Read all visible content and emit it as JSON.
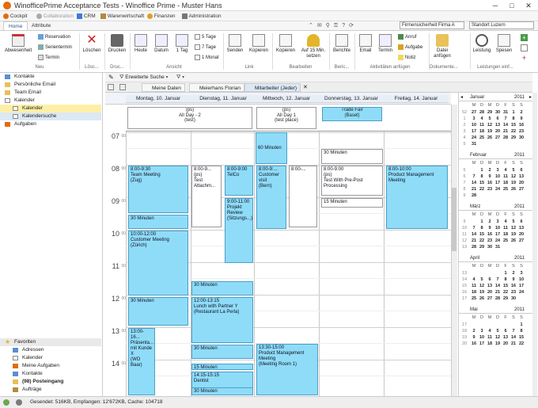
{
  "window": {
    "title": "WinofficePrime Acceptance Tests - Winoffice Prime - Muster Hans"
  },
  "topbar": {
    "items": [
      "Cockpit",
      "Collaboration",
      "CRM",
      "Warenwirtschaft",
      "Finanzen",
      "Administration"
    ],
    "company_select": "Firmensicherheit Firma A",
    "location_select": "Standort Luzern"
  },
  "ribbon": {
    "tabs": [
      "Home",
      "Attribute"
    ],
    "neu": {
      "label": "Neu",
      "absenheit": "Abwesenheit",
      "reservation": "Reservation",
      "serientermin": "Serientermin",
      "termin": "Termin"
    },
    "loeschen": {
      "label": "Lösc...",
      "button": "Löschen"
    },
    "druck": {
      "label": "Druc...",
      "button": "Drucken"
    },
    "ansicht": {
      "label": "Ansicht",
      "heute": "Heute",
      "datum": "Datum",
      "tag": "1 Tag",
      "tage5": "5 Tage",
      "tage7": "7 Tage",
      "monat": "1 Monat"
    },
    "link": {
      "label": "Link",
      "senden": "Senden",
      "kopieren": "Kopieren"
    },
    "bearbeiten": {
      "label": "Bearbeiten",
      "kopieren": "Kopieren",
      "auf15": "Auf 15 Min. setzen"
    },
    "berichte": {
      "label": "Beric...",
      "button": "Berichte"
    },
    "aktivitaeten": {
      "label": "Aktivitäten anfügen",
      "email": "Email",
      "termin": "Termin",
      "anruf": "Anruf",
      "aufgabe": "Aufgabe",
      "notiz": "Notiz"
    },
    "dokumente": {
      "label": "Dokumente...",
      "datei": "Datei anfügen"
    },
    "leistungen": {
      "label": "Leistungen einf...",
      "leistung": "Leistung",
      "spesen": "Spesen"
    }
  },
  "nav": {
    "items": [
      {
        "label": "Kontakte"
      },
      {
        "label": "Persönliche Email"
      },
      {
        "label": "Team Email"
      },
      {
        "label": "Kalender"
      },
      {
        "label": "Kalender"
      },
      {
        "label": "Kalendersuche"
      },
      {
        "label": "Aufgaben"
      }
    ],
    "favorites_title": "Favoriten",
    "favorites": [
      {
        "label": "Adressen"
      },
      {
        "label": "Kalender"
      },
      {
        "label": "Meine Aufgaben"
      },
      {
        "label": "Kontakte"
      },
      {
        "label": "(98) Posteingang"
      },
      {
        "label": "Aufträge"
      }
    ]
  },
  "toolbar": {
    "filter": "Erweiterte Suche"
  },
  "viewtabs": [
    "Meine Daten",
    "Meierhans Florian",
    "Mitarbeiter (Jeder)"
  ],
  "days": [
    "Montag, 10. Januar",
    "Dienstag, 11. Januar",
    "Mittwoch, 12. Januar",
    "Donnerstag, 13. Januar",
    "Freitag, 14. Januar"
  ],
  "hours": [
    "07",
    "08",
    "09",
    "10",
    "11",
    "12",
    "13",
    "14"
  ],
  "hour_suffix": "00",
  "allday": [
    {
      "text": "(ps)\nAll Day - 2\n(test)"
    },
    {
      "text": "(ps)\nAll Day 1\n(test place)"
    },
    {
      "text": "Trade Fair\n(Basel)"
    }
  ],
  "appointments": [
    {
      "text": "8:00-9:30\nTeam Meeting\n(Zug)"
    },
    {
      "text": "30 Minuten"
    },
    {
      "text": "10:00-12:00\nCustomer Meeting\n(Zürich)"
    },
    {
      "text": "30 Minuten"
    },
    {
      "text": "13:00-16...\nPräsenta...\nmit Kunde X\n(WO Baar)"
    },
    {
      "text": "8:00-9...\n(ps)\nTest\nAttachm..."
    },
    {
      "text": "8:00-9:00\nTelCo"
    },
    {
      "text": "9:00-11:00\nProjekt\nReview\n(Sitzungs...)"
    },
    {
      "text": "30 Minuten"
    },
    {
      "text": "12:00-13:15\nLunch with Partner Y\n(Restaurant La Perla)"
    },
    {
      "text": "30 Minuten"
    },
    {
      "text": "15 Minuten"
    },
    {
      "text": "14:15-15:15\nDentist"
    },
    {
      "text": "30 Minuten"
    },
    {
      "text": "8:00-9:...\nCustomer\nvisit\n(Bern)"
    },
    {
      "text": "8:00-..."
    },
    {
      "text": "60 Minuten"
    },
    {
      "text": "13:30-15:00\nProduct Management\nMeeting\n(Meeting Room 1)"
    },
    {
      "text": "30 Minuten"
    },
    {
      "text": "8:00-9:00\n(ps)\nTest With Pre-Post\nProcessing"
    },
    {
      "text": "15 Minuten"
    },
    {
      "text": "8:00-10:00\nProduct Management\nMeeting"
    }
  ],
  "minical": {
    "year": "2011",
    "weekdays": [
      "M",
      "D",
      "M",
      "D",
      "F",
      "S",
      "S"
    ],
    "months": [
      {
        "name": "Januar",
        "rows": [
          [
            "52",
            "27",
            "28",
            "29",
            "30",
            "31",
            "1",
            "2"
          ],
          [
            "1",
            "3",
            "4",
            "5",
            "6",
            "7",
            "8",
            "9"
          ],
          [
            "2",
            "10",
            "11",
            "12",
            "13",
            "14",
            "15",
            "16"
          ],
          [
            "3",
            "17",
            "18",
            "19",
            "20",
            "21",
            "22",
            "23"
          ],
          [
            "4",
            "24",
            "25",
            "26",
            "27",
            "28",
            "29",
            "30"
          ],
          [
            "5",
            "31",
            "",
            "",
            "",
            "",
            "",
            ""
          ]
        ]
      },
      {
        "name": "Februar",
        "rows": [
          [
            "5",
            "",
            "1",
            "2",
            "3",
            "4",
            "5",
            "6"
          ],
          [
            "6",
            "7",
            "8",
            "9",
            "10",
            "11",
            "12",
            "13"
          ],
          [
            "7",
            "14",
            "15",
            "16",
            "17",
            "18",
            "19",
            "20"
          ],
          [
            "8",
            "21",
            "22",
            "23",
            "24",
            "25",
            "26",
            "27"
          ],
          [
            "9",
            "28",
            "",
            "",
            "",
            "",
            "",
            ""
          ]
        ]
      },
      {
        "name": "März",
        "rows": [
          [
            "9",
            "",
            "1",
            "2",
            "3",
            "4",
            "5",
            "6"
          ],
          [
            "10",
            "7",
            "8",
            "9",
            "10",
            "11",
            "12",
            "13"
          ],
          [
            "11",
            "14",
            "15",
            "16",
            "17",
            "18",
            "19",
            "20"
          ],
          [
            "12",
            "21",
            "22",
            "23",
            "24",
            "25",
            "26",
            "27"
          ],
          [
            "13",
            "28",
            "29",
            "30",
            "31",
            "",
            "",
            ""
          ]
        ]
      },
      {
        "name": "April",
        "rows": [
          [
            "13",
            "",
            "",
            "",
            "",
            "1",
            "2",
            "3"
          ],
          [
            "14",
            "4",
            "5",
            "6",
            "7",
            "8",
            "9",
            "10"
          ],
          [
            "15",
            "11",
            "12",
            "13",
            "14",
            "15",
            "16",
            "17"
          ],
          [
            "16",
            "18",
            "19",
            "20",
            "21",
            "22",
            "23",
            "24"
          ],
          [
            "17",
            "25",
            "26",
            "27",
            "28",
            "29",
            "30",
            ""
          ]
        ]
      },
      {
        "name": "Mai",
        "rows": [
          [
            "17",
            "",
            "",
            "",
            "",
            "",
            "",
            "1"
          ],
          [
            "18",
            "2",
            "3",
            "4",
            "5",
            "6",
            "7",
            "8"
          ],
          [
            "19",
            "9",
            "10",
            "11",
            "12",
            "13",
            "14",
            "15"
          ],
          [
            "20",
            "16",
            "17",
            "18",
            "19",
            "20",
            "21",
            "22"
          ]
        ]
      }
    ]
  },
  "status": {
    "text": "Gesendet: 516KB, Empfangen: 12'672KB, Cache: 104718"
  },
  "colors": {
    "appt": "#8fdcf8",
    "appt_border": "#4a9fc8",
    "selected": "#fdf0a6",
    "header": "#e8eef7"
  }
}
